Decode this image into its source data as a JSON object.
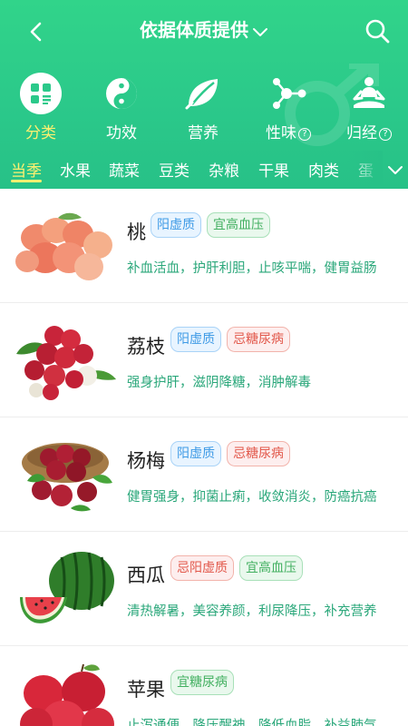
{
  "header": {
    "title": "依据体质提供",
    "categories": [
      {
        "label": "分类",
        "icon": "category-grid-icon",
        "active": true
      },
      {
        "label": "功效",
        "icon": "yin-yang-icon",
        "active": false
      },
      {
        "label": "营养",
        "icon": "leaf-icon",
        "active": false
      },
      {
        "label": "性味",
        "icon": "molecule-icon",
        "active": false,
        "help": "?"
      },
      {
        "label": "归经",
        "icon": "meditation-icon",
        "active": false,
        "help": "?"
      }
    ],
    "tabs": [
      "当季",
      "水果",
      "蔬菜",
      "豆类",
      "杂粮",
      "干果",
      "肉类",
      "蛋"
    ],
    "active_tab": "当季"
  },
  "foods": [
    {
      "name": "桃",
      "image": "peach-image",
      "tags": [
        {
          "text": "阳虚质",
          "kind": "blue"
        },
        {
          "text": "宜高血压",
          "kind": "green"
        }
      ],
      "desc": "补血活血，护肝利胆，止咳平喘，健胃益肠"
    },
    {
      "name": "荔枝",
      "image": "lychee-image",
      "tags": [
        {
          "text": "阳虚质",
          "kind": "blue"
        },
        {
          "text": "忌糖尿病",
          "kind": "red"
        }
      ],
      "desc": "强身护肝，滋阴降糖，消肿解毒"
    },
    {
      "name": "杨梅",
      "image": "bayberry-image",
      "tags": [
        {
          "text": "阳虚质",
          "kind": "blue"
        },
        {
          "text": "忌糖尿病",
          "kind": "red"
        }
      ],
      "desc": "健胃强身，抑菌止痢，收敛消炎，防癌抗癌"
    },
    {
      "name": "西瓜",
      "image": "watermelon-image",
      "tags": [
        {
          "text": "忌阳虚质",
          "kind": "red"
        },
        {
          "text": "宜高血压",
          "kind": "green"
        }
      ],
      "desc": "清热解暑，美容养颜，利尿降压，补充营养"
    },
    {
      "name": "苹果",
      "image": "apple-image",
      "tags": [
        {
          "text": "宜糖尿病",
          "kind": "green"
        }
      ],
      "desc": "止泻通便，降压醒神，降低血脂，补益肺气"
    }
  ],
  "colors": {
    "primary": "#2bc98a",
    "active_text": "#fdf070",
    "desc_text": "#2aa77a"
  }
}
